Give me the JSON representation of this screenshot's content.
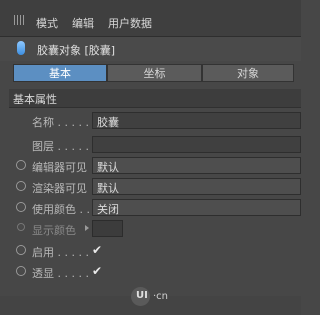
{
  "menubar": {
    "items": [
      "模式",
      "编辑",
      "用户数据"
    ]
  },
  "object": {
    "title": "胶囊对象 [胶囊]"
  },
  "tabs": [
    {
      "label": "基本",
      "active": true
    },
    {
      "label": "坐标",
      "active": false
    },
    {
      "label": "对象",
      "active": false
    }
  ],
  "section": {
    "title": "基本属性"
  },
  "fields": {
    "name_label": "名称 . . . . .",
    "name_value": "胶囊",
    "layer_label": "图层 . . . . .",
    "layer_value": "",
    "editor_visible_label": "编辑器可见",
    "editor_visible_value": "默认",
    "render_visible_label": "渲染器可见",
    "render_visible_value": "默认",
    "use_color_label": "使用颜色 . .",
    "use_color_value": "关闭",
    "display_color_label": "显示颜色",
    "enable_label": "启用 . . . . .",
    "enable_value": "✔",
    "xray_label": "透显 . . . . .",
    "xray_value": "✔"
  },
  "watermark": {
    "logo": "UI",
    "suffix": "·cn"
  },
  "colors": {
    "accent_tab": "#5c8fc2",
    "panel": "#474747",
    "capsule_icon": "#4a9be8"
  }
}
